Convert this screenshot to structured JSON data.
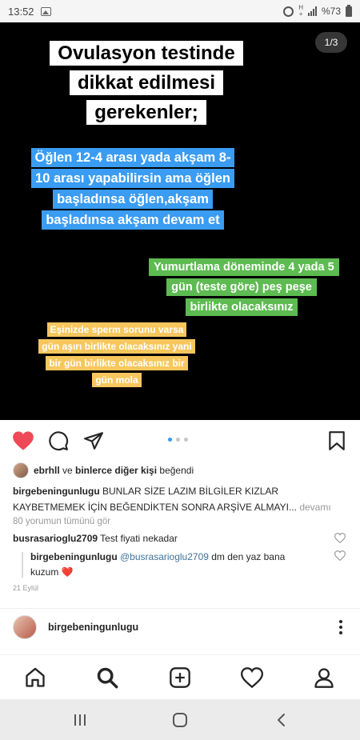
{
  "status_bar": {
    "time": "13:52",
    "network_label": "H",
    "network_sub": "+",
    "battery": "%73"
  },
  "post": {
    "counter": "1/3",
    "title": "Ovulasyon testinde dikkat edilmesi gerekenler;",
    "blue_text": "Öğlen 12-4 arası yada akşam 8-10 arası yapabilirsin ama öğlen başladınsa öğlen,akşam başladınsa akşam devam et",
    "green_text": "Yumurtlama döneminde 4 yada 5 gün (teste göre) peş peşe birlikte olacaksınız",
    "yellow_text": "Eşinizde sperm sorunu varsa gün aşırı birlikte olacaksınız yani bir gün birlikte olacaksınız bir gün mola",
    "colors": {
      "blue": "#3a9cf2",
      "green": "#5dbb51",
      "yellow": "#f7c75e",
      "like_red": "#ed4956"
    }
  },
  "actions": {
    "like_icon": "heart-filled-icon",
    "comment_icon": "comment-icon",
    "share_icon": "send-icon",
    "save_icon": "bookmark-icon"
  },
  "likes": {
    "user": "ebrhll",
    "connector": " ve ",
    "others": "binlerce diğer kişi",
    "suffix": " beğendi"
  },
  "caption": {
    "username": "birgebeningunlugu",
    "text": " BUNLAR SİZE LAZIM BİLGİLER KIZLAR KAYBETMEMEK İÇİN BEĞENDİKTEN SONRA ARŞİVE ALMAYI...",
    "more": " devamı"
  },
  "view_comments": "80 yorumun tümünü gör",
  "comments": [
    {
      "username": "busrasarioglu2709",
      "text": " Test fiyati nekadar"
    },
    {
      "username": "birgebeningunlugu",
      "mention": "@busrasarioglu2709",
      "text": " dm den yaz bana kuzum",
      "emoji": "❤️"
    }
  ],
  "date": "21 Eylül",
  "next_post": {
    "username": "birgebeningunlugu"
  }
}
